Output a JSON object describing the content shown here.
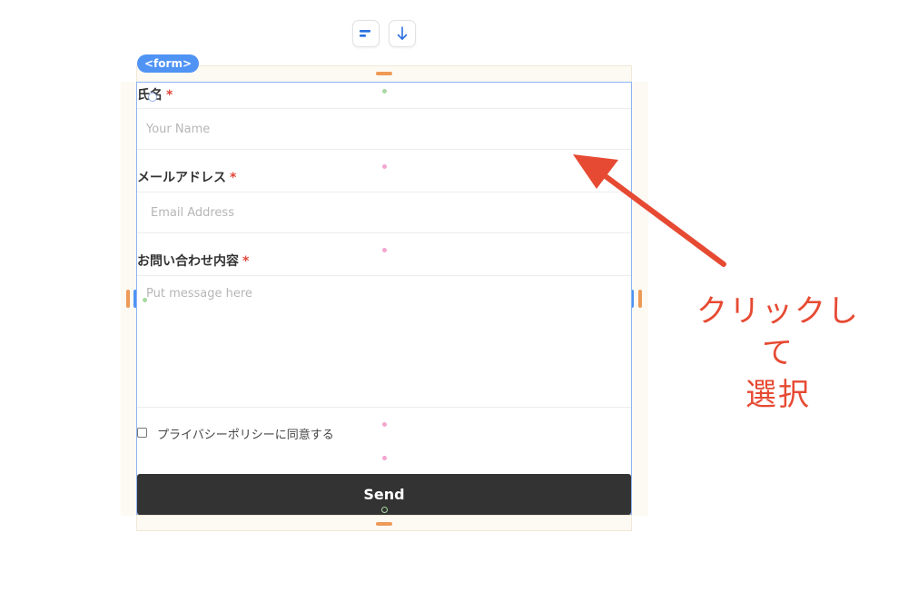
{
  "toolbar": {
    "align_icon": "align-left-icon",
    "down_icon": "arrow-down-icon"
  },
  "element_tag": "<form>",
  "form": {
    "name_label": "氏名",
    "name_placeholder": "Your Name",
    "email_label": "メールアドレス",
    "email_placeholder": "Email Address",
    "message_label": "お問い合わせ内容",
    "message_placeholder": "Put message here",
    "required_mark": "*",
    "privacy_label": "プライバシーポリシーに同意する",
    "send_label": "Send"
  },
  "annotation": {
    "line1": "クリックして",
    "line2": "選択"
  },
  "colors": {
    "selection_blue": "#4f93f5",
    "padding_orange": "#ee9a57",
    "annotation_red": "#e64a33",
    "send_dark": "#333333"
  }
}
